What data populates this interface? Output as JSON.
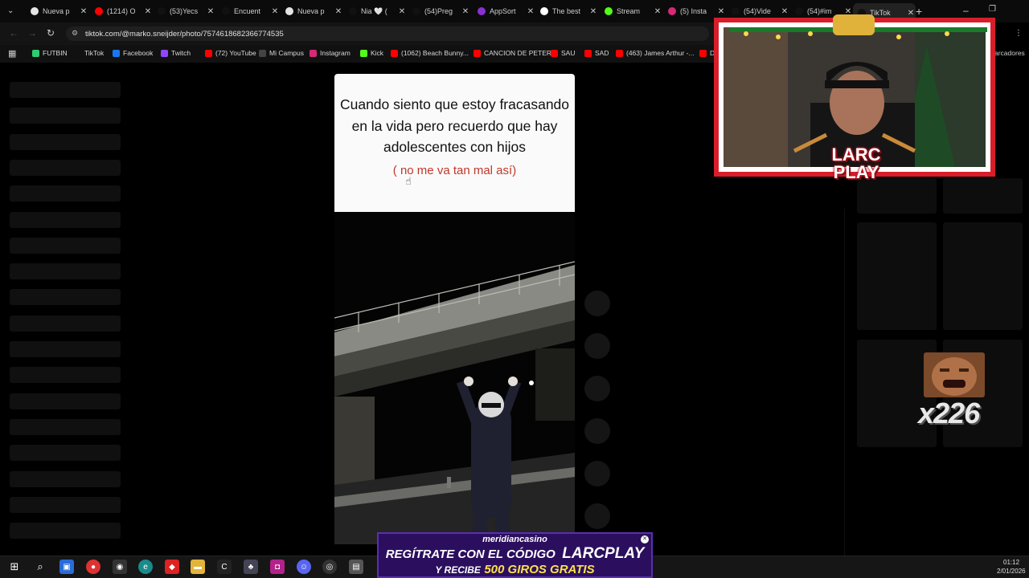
{
  "tabs": [
    {
      "label": "Nueva p",
      "icon": "github-icon"
    },
    {
      "label": "(1214) O",
      "icon": "youtube-icon"
    },
    {
      "label": "(53)Yecs",
      "icon": "tiktok-icon"
    },
    {
      "label": "Encuent",
      "icon": "tiktok-icon"
    },
    {
      "label": "Nueva p",
      "icon": "github-icon"
    },
    {
      "label": "Nia 🤍 (",
      "icon": "tiktok-icon"
    },
    {
      "label": "(54)Preg",
      "icon": "tiktok-icon"
    },
    {
      "label": "AppSort",
      "icon": "appsort-icon"
    },
    {
      "label": "The best",
      "icon": "chatgpt-icon"
    },
    {
      "label": "Stream",
      "icon": "kick-icon"
    },
    {
      "label": "(5) Insta",
      "icon": "instagram-icon"
    },
    {
      "label": "(54)Vide",
      "icon": "tiktok-icon"
    },
    {
      "label": "(54)#im",
      "icon": "tiktok-icon"
    },
    {
      "label": "TikTok",
      "icon": "tiktok-icon"
    }
  ],
  "address_bar": {
    "url": "tiktok.com/@marko.sneijder/photo/7574618682366774535"
  },
  "bookmarks": [
    {
      "label": "FUTBIN",
      "color": "#2ecc71"
    },
    {
      "label": "TikTok",
      "color": "#111111"
    },
    {
      "label": "Facebook",
      "color": "#1877f2"
    },
    {
      "label": "Twitch",
      "color": "#9146ff"
    },
    {
      "label": "(72) YouTube",
      "color": "#ff0000"
    },
    {
      "label": "Mi Campus",
      "color": "#444444"
    },
    {
      "label": "Instagram",
      "color": "#d62976"
    },
    {
      "label": "Kick",
      "color": "#53fc18"
    },
    {
      "label": "(1062) Beach Bunny...",
      "color": "#ff0000"
    },
    {
      "label": "CANCION DE PETER",
      "color": "#ff0000"
    },
    {
      "label": "SAU",
      "color": "#ff0000"
    },
    {
      "label": "SAD",
      "color": "#ff0000"
    },
    {
      "label": "(463) James Arthur -...",
      "color": "#ff0000"
    },
    {
      "label": "Dr",
      "color": "#ff0000"
    }
  ],
  "bookmarks_overflow": "arcadores",
  "post": {
    "caption": "Cuando siento que estoy fracasando en la vida pero recuerdo que hay adolescentes con hijos",
    "subcaption": "( no me va tan mal así)"
  },
  "stream_overlay": {
    "logo_line1": "LARC",
    "logo_line2": "PLAY",
    "emote_count": "x226"
  },
  "ad": {
    "brand": "meridiancasino",
    "line1_prefix": "REGÍTRATE CON EL CÓDIGO",
    "code": "LARCPLAY",
    "line2_prefix": "Y RECIBE",
    "line2_highlight": "500 GIROS GRATIS"
  },
  "clock": {
    "time": "01:12",
    "date": "2/01/2026"
  }
}
